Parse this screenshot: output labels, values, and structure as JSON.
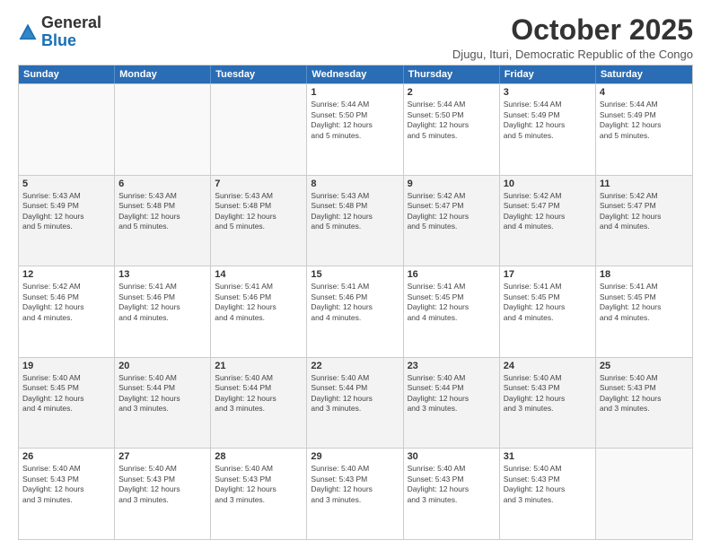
{
  "logo": {
    "general": "General",
    "blue": "Blue"
  },
  "header": {
    "month": "October 2025",
    "location": "Djugu, Ituri, Democratic Republic of the Congo"
  },
  "weekdays": [
    "Sunday",
    "Monday",
    "Tuesday",
    "Wednesday",
    "Thursday",
    "Friday",
    "Saturday"
  ],
  "rows": [
    [
      {
        "day": "",
        "text": ""
      },
      {
        "day": "",
        "text": ""
      },
      {
        "day": "",
        "text": ""
      },
      {
        "day": "1",
        "text": "Sunrise: 5:44 AM\nSunset: 5:50 PM\nDaylight: 12 hours\nand 5 minutes."
      },
      {
        "day": "2",
        "text": "Sunrise: 5:44 AM\nSunset: 5:50 PM\nDaylight: 12 hours\nand 5 minutes."
      },
      {
        "day": "3",
        "text": "Sunrise: 5:44 AM\nSunset: 5:49 PM\nDaylight: 12 hours\nand 5 minutes."
      },
      {
        "day": "4",
        "text": "Sunrise: 5:44 AM\nSunset: 5:49 PM\nDaylight: 12 hours\nand 5 minutes."
      }
    ],
    [
      {
        "day": "5",
        "text": "Sunrise: 5:43 AM\nSunset: 5:49 PM\nDaylight: 12 hours\nand 5 minutes."
      },
      {
        "day": "6",
        "text": "Sunrise: 5:43 AM\nSunset: 5:48 PM\nDaylight: 12 hours\nand 5 minutes."
      },
      {
        "day": "7",
        "text": "Sunrise: 5:43 AM\nSunset: 5:48 PM\nDaylight: 12 hours\nand 5 minutes."
      },
      {
        "day": "8",
        "text": "Sunrise: 5:43 AM\nSunset: 5:48 PM\nDaylight: 12 hours\nand 5 minutes."
      },
      {
        "day": "9",
        "text": "Sunrise: 5:42 AM\nSunset: 5:47 PM\nDaylight: 12 hours\nand 5 minutes."
      },
      {
        "day": "10",
        "text": "Sunrise: 5:42 AM\nSunset: 5:47 PM\nDaylight: 12 hours\nand 4 minutes."
      },
      {
        "day": "11",
        "text": "Sunrise: 5:42 AM\nSunset: 5:47 PM\nDaylight: 12 hours\nand 4 minutes."
      }
    ],
    [
      {
        "day": "12",
        "text": "Sunrise: 5:42 AM\nSunset: 5:46 PM\nDaylight: 12 hours\nand 4 minutes."
      },
      {
        "day": "13",
        "text": "Sunrise: 5:41 AM\nSunset: 5:46 PM\nDaylight: 12 hours\nand 4 minutes."
      },
      {
        "day": "14",
        "text": "Sunrise: 5:41 AM\nSunset: 5:46 PM\nDaylight: 12 hours\nand 4 minutes."
      },
      {
        "day": "15",
        "text": "Sunrise: 5:41 AM\nSunset: 5:46 PM\nDaylight: 12 hours\nand 4 minutes."
      },
      {
        "day": "16",
        "text": "Sunrise: 5:41 AM\nSunset: 5:45 PM\nDaylight: 12 hours\nand 4 minutes."
      },
      {
        "day": "17",
        "text": "Sunrise: 5:41 AM\nSunset: 5:45 PM\nDaylight: 12 hours\nand 4 minutes."
      },
      {
        "day": "18",
        "text": "Sunrise: 5:41 AM\nSunset: 5:45 PM\nDaylight: 12 hours\nand 4 minutes."
      }
    ],
    [
      {
        "day": "19",
        "text": "Sunrise: 5:40 AM\nSunset: 5:45 PM\nDaylight: 12 hours\nand 4 minutes."
      },
      {
        "day": "20",
        "text": "Sunrise: 5:40 AM\nSunset: 5:44 PM\nDaylight: 12 hours\nand 3 minutes."
      },
      {
        "day": "21",
        "text": "Sunrise: 5:40 AM\nSunset: 5:44 PM\nDaylight: 12 hours\nand 3 minutes."
      },
      {
        "day": "22",
        "text": "Sunrise: 5:40 AM\nSunset: 5:44 PM\nDaylight: 12 hours\nand 3 minutes."
      },
      {
        "day": "23",
        "text": "Sunrise: 5:40 AM\nSunset: 5:44 PM\nDaylight: 12 hours\nand 3 minutes."
      },
      {
        "day": "24",
        "text": "Sunrise: 5:40 AM\nSunset: 5:43 PM\nDaylight: 12 hours\nand 3 minutes."
      },
      {
        "day": "25",
        "text": "Sunrise: 5:40 AM\nSunset: 5:43 PM\nDaylight: 12 hours\nand 3 minutes."
      }
    ],
    [
      {
        "day": "26",
        "text": "Sunrise: 5:40 AM\nSunset: 5:43 PM\nDaylight: 12 hours\nand 3 minutes."
      },
      {
        "day": "27",
        "text": "Sunrise: 5:40 AM\nSunset: 5:43 PM\nDaylight: 12 hours\nand 3 minutes."
      },
      {
        "day": "28",
        "text": "Sunrise: 5:40 AM\nSunset: 5:43 PM\nDaylight: 12 hours\nand 3 minutes."
      },
      {
        "day": "29",
        "text": "Sunrise: 5:40 AM\nSunset: 5:43 PM\nDaylight: 12 hours\nand 3 minutes."
      },
      {
        "day": "30",
        "text": "Sunrise: 5:40 AM\nSunset: 5:43 PM\nDaylight: 12 hours\nand 3 minutes."
      },
      {
        "day": "31",
        "text": "Sunrise: 5:40 AM\nSunset: 5:43 PM\nDaylight: 12 hours\nand 3 minutes."
      },
      {
        "day": "",
        "text": ""
      }
    ]
  ]
}
